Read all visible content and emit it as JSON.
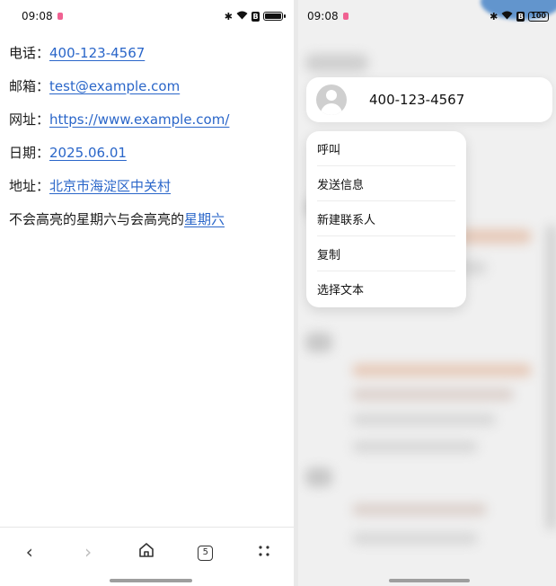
{
  "left": {
    "status": {
      "time": "09:08"
    },
    "lines": [
      {
        "label": "电话：",
        "link": "400-123-4567"
      },
      {
        "label": "邮箱：",
        "link": "test@example.com"
      },
      {
        "label": "网址：",
        "link": "https://www.example.com/"
      },
      {
        "label": "日期：",
        "link": "2025.06.01"
      },
      {
        "label": "地址：",
        "link": "北京市海淀区中关村"
      },
      {
        "label": "不会高亮的星期六与会高亮的",
        "link": "星期六"
      }
    ],
    "nav": {
      "back": "‹",
      "forward": "›",
      "home": "⌂",
      "tabs": "5",
      "more": "⋮⋮"
    }
  },
  "right": {
    "status": {
      "time": "09:08",
      "battery": "100"
    },
    "contact": {
      "number": "400-123-4567"
    },
    "menu": [
      "呼叫",
      "发送信息",
      "新建联系人",
      "复制",
      "选择文本"
    ]
  }
}
